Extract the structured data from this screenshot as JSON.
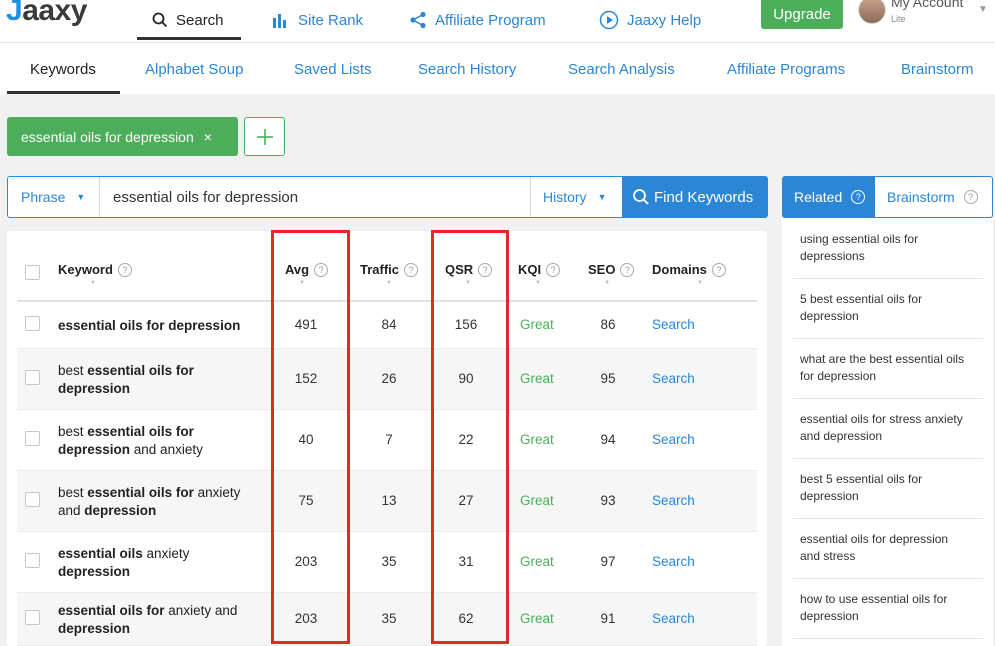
{
  "header": {
    "logo_text": "Jaaxy",
    "nav": [
      {
        "label": "Search",
        "icon": "search-icon"
      },
      {
        "label": "Site Rank",
        "icon": "bar-chart-icon"
      },
      {
        "label": "Affiliate Program",
        "icon": "share-icon"
      },
      {
        "label": "Jaaxy Help",
        "icon": "play-circle-icon"
      }
    ],
    "upgrade_label": "Upgrade",
    "account": {
      "name": "My Account",
      "plan": "Lite"
    }
  },
  "subnav": [
    "Keywords",
    "Alphabet Soup",
    "Saved Lists",
    "Search History",
    "Search Analysis",
    "Affiliate Programs",
    "Brainstorm"
  ],
  "chip": {
    "label": "essential oils for depression",
    "close": "×"
  },
  "search": {
    "mode": "Phrase",
    "query": "essential oils for depression",
    "history_label": "History",
    "find_label": "Find Keywords"
  },
  "table": {
    "columns": [
      "Keyword",
      "Avg",
      "Traffic",
      "QSR",
      "KQI",
      "SEO",
      "Domains"
    ],
    "rows": [
      {
        "kw_parts": [
          {
            "t": "essential oils for depression",
            "b": true
          }
        ],
        "avg": "491",
        "traffic": "84",
        "qsr": "156",
        "kqi": "Great",
        "seo": "86",
        "domains": "Search"
      },
      {
        "kw_parts": [
          {
            "t": "best ",
            "b": false
          },
          {
            "t": "essential oils for depression",
            "b": true
          }
        ],
        "avg": "152",
        "traffic": "26",
        "qsr": "90",
        "kqi": "Great",
        "seo": "95",
        "domains": "Search"
      },
      {
        "kw_parts": [
          {
            "t": "best ",
            "b": false
          },
          {
            "t": "essential oils for depression",
            "b": true
          },
          {
            "t": " and anxiety",
            "b": false
          }
        ],
        "avg": "40",
        "traffic": "7",
        "qsr": "22",
        "kqi": "Great",
        "seo": "94",
        "domains": "Search"
      },
      {
        "kw_parts": [
          {
            "t": "best ",
            "b": false
          },
          {
            "t": "essential oils for",
            "b": true
          },
          {
            "t": " anxiety and ",
            "b": false
          },
          {
            "t": "depression",
            "b": true
          }
        ],
        "avg": "75",
        "traffic": "13",
        "qsr": "27",
        "kqi": "Great",
        "seo": "93",
        "domains": "Search"
      },
      {
        "kw_parts": [
          {
            "t": "essential oils",
            "b": true
          },
          {
            "t": " anxiety ",
            "b": false
          },
          {
            "t": "depression",
            "b": true
          }
        ],
        "avg": "203",
        "traffic": "35",
        "qsr": "31",
        "kqi": "Great",
        "seo": "97",
        "domains": "Search"
      },
      {
        "kw_parts": [
          {
            "t": "essential oils for",
            "b": true
          },
          {
            "t": " anxiety and ",
            "b": false
          },
          {
            "t": "depression",
            "b": true
          }
        ],
        "avg": "203",
        "traffic": "35",
        "qsr": "62",
        "kqi": "Great",
        "seo": "91",
        "domains": "Search"
      }
    ]
  },
  "sidebar": {
    "tabs": [
      "Related",
      "Brainstorm"
    ],
    "related": [
      "using essential oils for depressions",
      "5 best essential oils for depression",
      "what are the best essential oils for depression",
      "essential oils for stress anxiety and depression",
      "best 5 essential oils for depression",
      "essential oils for depression and stress",
      "how to use essential oils for depression"
    ]
  },
  "colors": {
    "accent": "#2b86d6",
    "green": "#4cae5b",
    "highlight": "#e4282a"
  }
}
